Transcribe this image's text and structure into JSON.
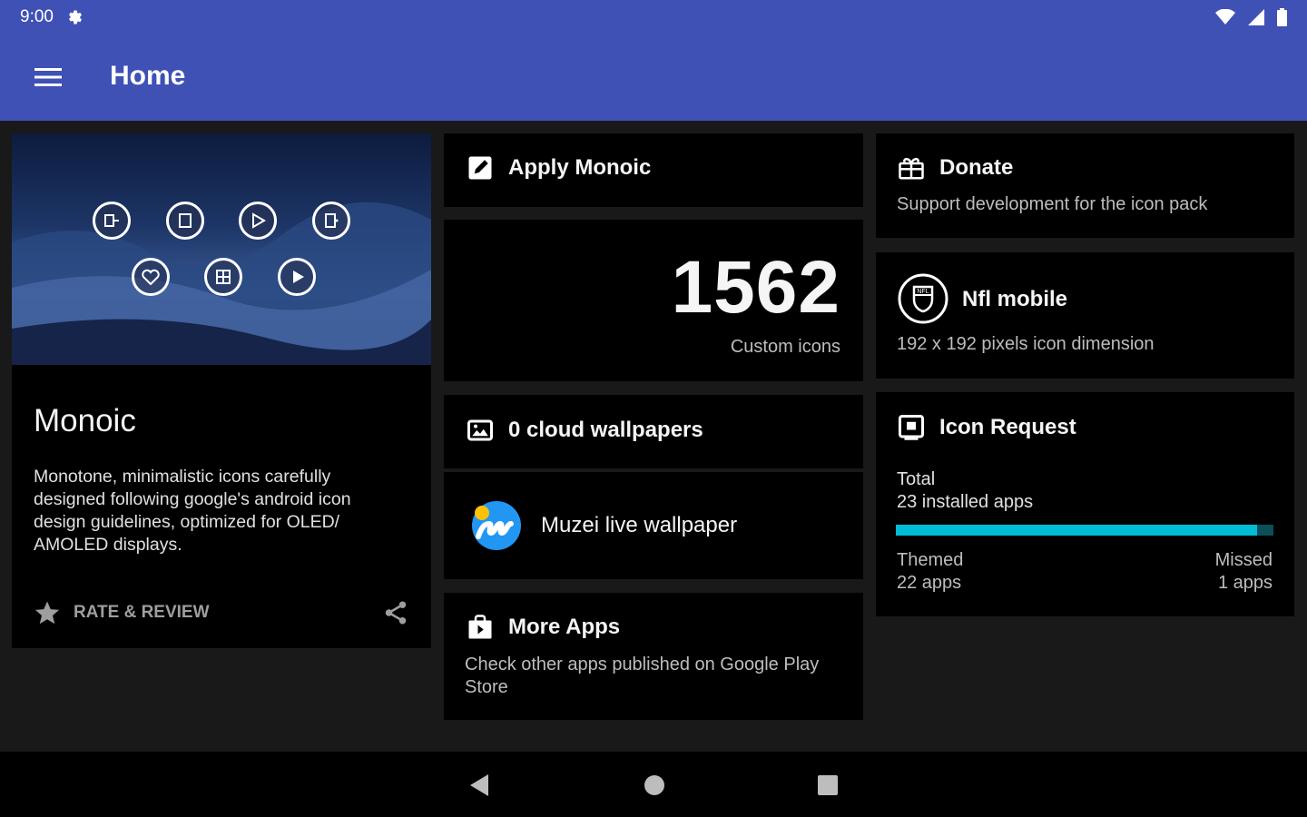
{
  "status": {
    "time": "9:00"
  },
  "appbar": {
    "title": "Home"
  },
  "info_card": {
    "name": "Monoic",
    "description": "Monotone, minimalistic icons carefully designed following google's android icon design guidelines, optimized for OLED/ AMOLED displays.",
    "rate_label": "RATE & REVIEW"
  },
  "apply_card": {
    "label": "Apply Monoic"
  },
  "count_card": {
    "count": "1562",
    "caption": "Custom icons"
  },
  "cloud_card": {
    "label": "0 cloud wallpapers"
  },
  "muzei_card": {
    "label": "Muzei live wallpaper"
  },
  "more_apps_card": {
    "title": "More Apps",
    "subtitle": "Check other apps published on Google Play Store"
  },
  "donate_card": {
    "title": "Donate",
    "subtitle": "Support development for the icon pack"
  },
  "nfl_card": {
    "title": "Nfl mobile",
    "subtitle": "192 x 192 pixels icon dimension"
  },
  "request_card": {
    "title": "Icon Request",
    "total_label": "Total",
    "installed": "23 installed apps",
    "themed_label": "Themed",
    "themed_count": "22 apps",
    "missed_label": "Missed",
    "missed_count": "1 apps",
    "progress": 0.957
  },
  "colors": {
    "primary": "#3f51b5",
    "accent": "#00bcd4",
    "card": "#000000",
    "background": "#191919"
  }
}
